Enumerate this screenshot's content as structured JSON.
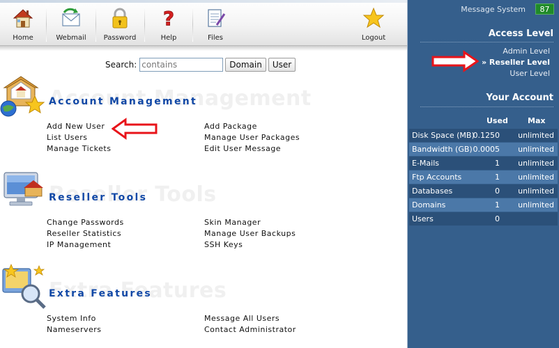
{
  "toolbar": {
    "items": [
      {
        "label": "Home",
        "icon": "home-icon"
      },
      {
        "label": "Webmail",
        "icon": "mail-envelope-icon"
      },
      {
        "label": "Password",
        "icon": "padlock-icon"
      },
      {
        "label": "Help",
        "icon": "question-mark-icon"
      },
      {
        "label": "Files",
        "icon": "document-icon"
      },
      {
        "label": "Logout",
        "icon": "star-icon"
      }
    ]
  },
  "search": {
    "label": "Search:",
    "value": "contains",
    "domain_button": "Domain",
    "user_button": "User"
  },
  "sections": {
    "account": {
      "title": "Account Management",
      "links": [
        "Add New User",
        "List Users",
        "Manage Tickets",
        "Add Package",
        "Manage User Packages",
        "Edit User Message"
      ]
    },
    "reseller": {
      "title": "Reseller Tools",
      "links": [
        "Change Passwords",
        "Reseller Statistics",
        "IP Management",
        "Skin Manager",
        "Manage User Backups",
        "SSH Keys"
      ]
    },
    "extra": {
      "title": "Extra Features",
      "links": [
        "System Info",
        "Nameservers",
        "Message All Users",
        "Contact Administrator"
      ]
    }
  },
  "panel": {
    "message_label": "Message System",
    "message_count": "87",
    "access_title": "Access Level",
    "levels": [
      "Admin Level",
      "» Reseller Level",
      "User Level"
    ],
    "account_title": "Your Account",
    "col_used": "Used",
    "col_max": "Max",
    "rows": [
      {
        "name": "Disk Space (MB)",
        "used": "0.1250",
        "max": "unlimited"
      },
      {
        "name": "Bandwidth (GB)",
        "used": "0.0005",
        "max": "unlimited"
      },
      {
        "name": "E-Mails",
        "used": "1",
        "max": "unlimited"
      },
      {
        "name": "Ftp Accounts",
        "used": "1",
        "max": "unlimited"
      },
      {
        "name": "Databases",
        "used": "0",
        "max": "unlimited"
      },
      {
        "name": "Domains",
        "used": "1",
        "max": "unlimited"
      },
      {
        "name": "Users",
        "used": "0",
        "max": ""
      }
    ]
  },
  "colors": {
    "panel_bg": "#355f8c",
    "section_title": "#1148a6",
    "annotation_arrow": "#e8141a",
    "message_badge": "#208a2a"
  }
}
